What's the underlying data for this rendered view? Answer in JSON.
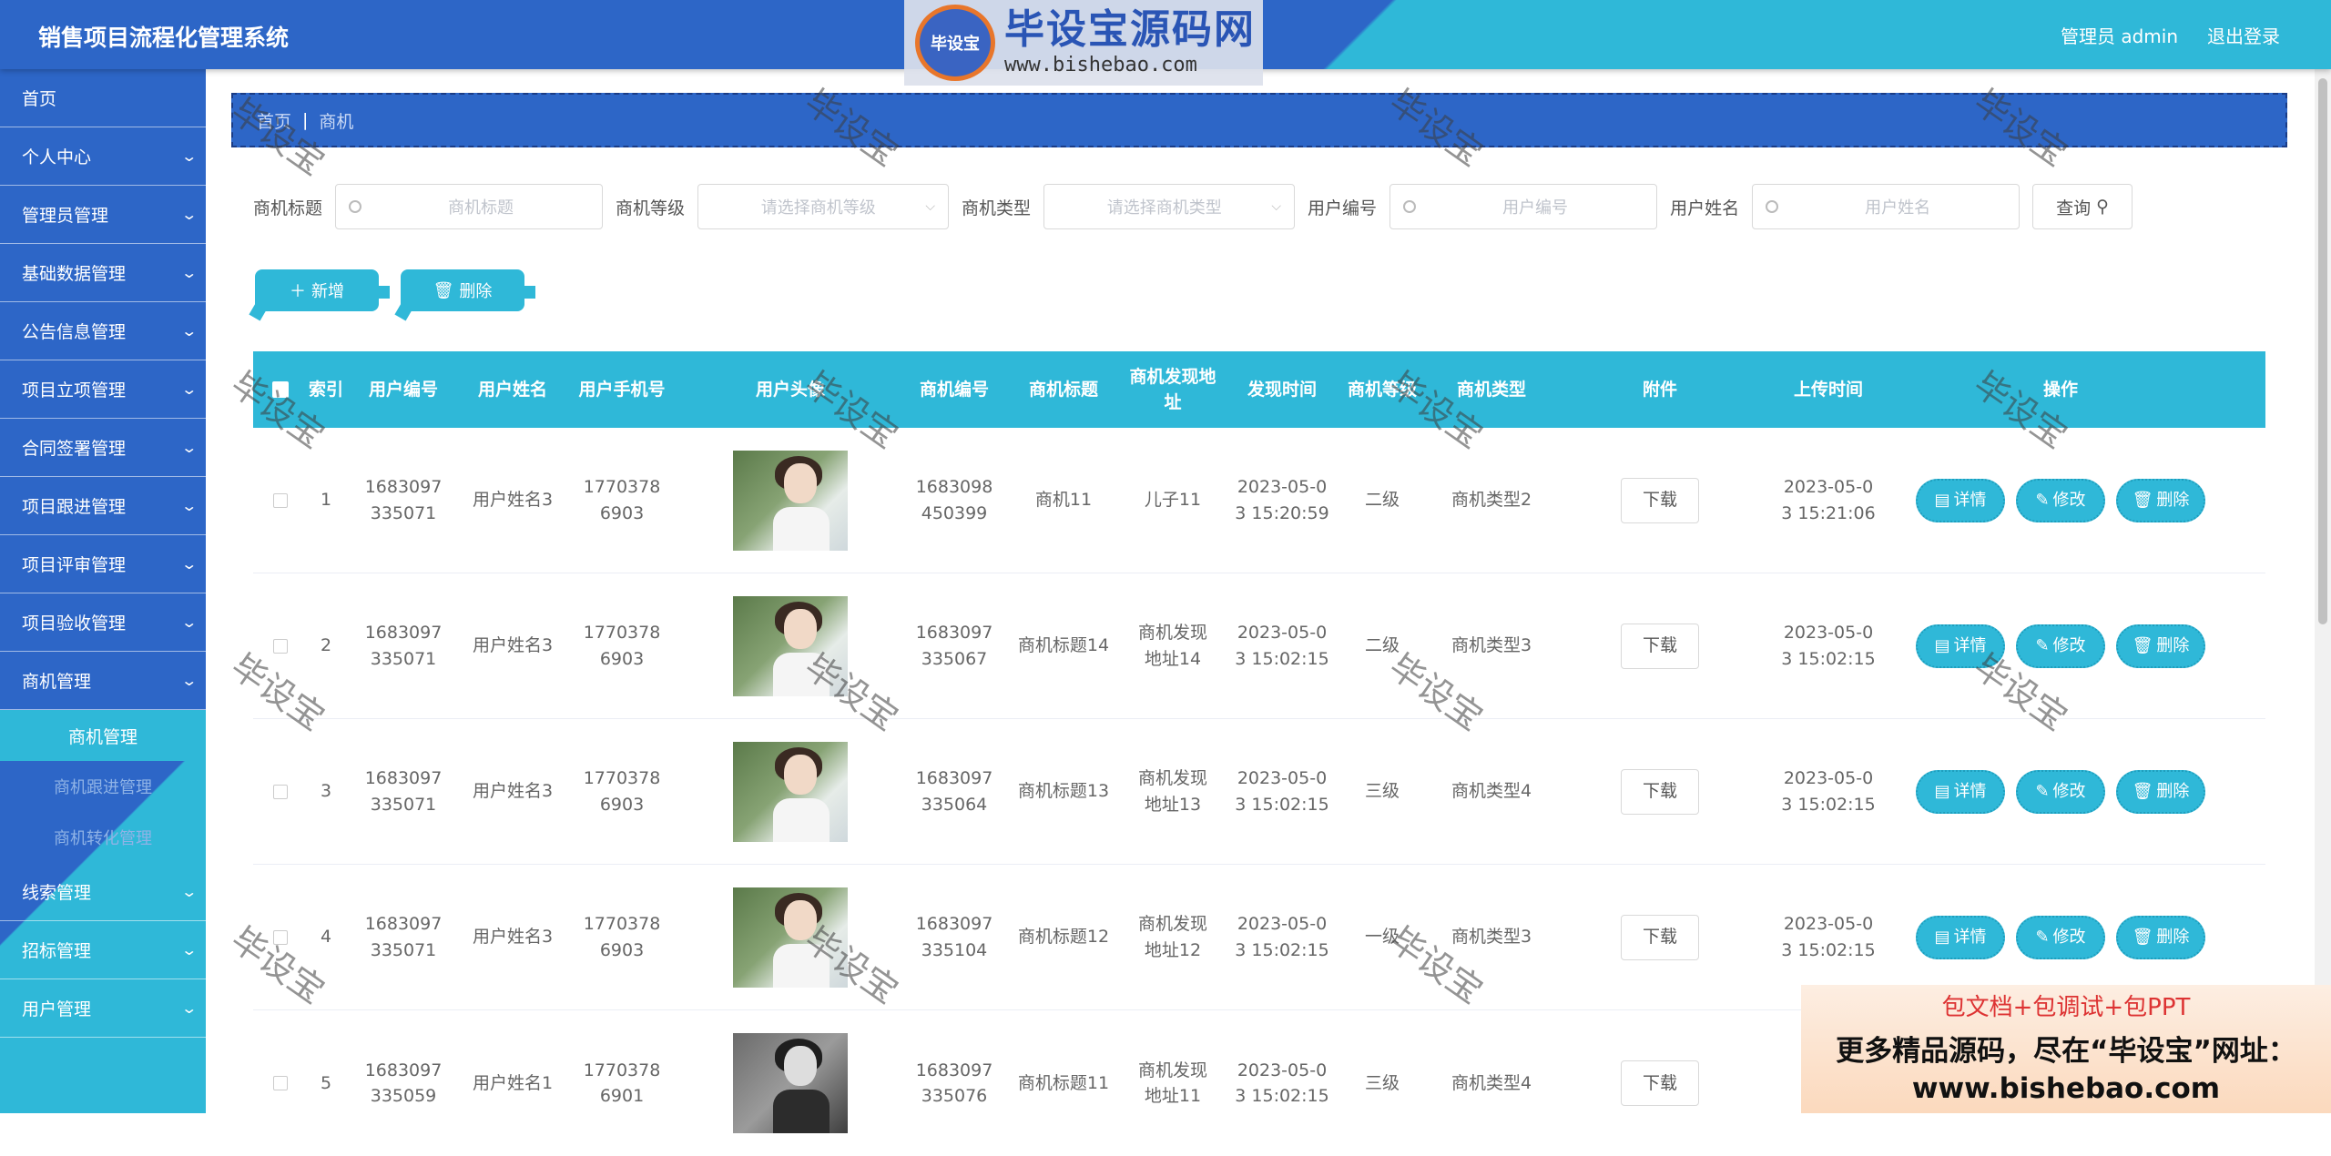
{
  "header": {
    "app_title": "销售项目流程化管理系统",
    "user_label": "管理员 admin",
    "logout": "退出登录",
    "logo_badge": "毕设宝",
    "logo_text": "毕设宝源码网",
    "logo_url": "www.bishebao.com"
  },
  "sidebar": {
    "items": [
      {
        "label": "首页"
      },
      {
        "label": "个人中心"
      },
      {
        "label": "管理员管理"
      },
      {
        "label": "基础数据管理"
      },
      {
        "label": "公告信息管理"
      },
      {
        "label": "项目立项管理"
      },
      {
        "label": "合同签署管理"
      },
      {
        "label": "项目跟进管理"
      },
      {
        "label": "项目评审管理"
      },
      {
        "label": "项目验收管理"
      },
      {
        "label": "商机管理"
      },
      {
        "label": "线索管理"
      },
      {
        "label": "招标管理"
      },
      {
        "label": "用户管理"
      }
    ],
    "sub_items": [
      "商机管理",
      "商机跟进管理",
      "商机转化管理"
    ]
  },
  "breadcrumb": {
    "home": "首页",
    "current": "商机"
  },
  "search": {
    "title_label": "商机标题",
    "title_ph": "商机标题",
    "level_label": "商机等级",
    "level_ph": "请选择商机等级",
    "type_label": "商机类型",
    "type_ph": "请选择商机类型",
    "uno_label": "用户编号",
    "uno_ph": "用户编号",
    "uname_label": "用户姓名",
    "uname_ph": "用户姓名",
    "query": "查询"
  },
  "actions": {
    "add": "新增",
    "delete": "删除"
  },
  "table": {
    "headers": [
      "索引",
      "用户编号",
      "用户姓名",
      "用户手机号",
      "用户头像",
      "商机编号",
      "商机标题",
      "商机发现地址",
      "发现时间",
      "商机等级",
      "商机类型",
      "附件",
      "上传时间",
      "操作"
    ],
    "download": "下载",
    "op_detail": "详情",
    "op_edit": "修改",
    "op_delete": "删除",
    "rows": [
      {
        "idx": "1",
        "uno": "1683097335071",
        "uname": "用户姓名3",
        "phone": "17703786903",
        "sno": "1683098450399",
        "stitle": "商机11",
        "saddr": "儿子11",
        "time": "2023-05-03 15:20:59",
        "level": "二级",
        "stype": "商机类型2",
        "up": "2023-05-03 15:21:06"
      },
      {
        "idx": "2",
        "uno": "1683097335071",
        "uname": "用户姓名3",
        "phone": "17703786903",
        "sno": "1683097335067",
        "stitle": "商机标题14",
        "saddr": "商机发现地址14",
        "time": "2023-05-03 15:02:15",
        "level": "二级",
        "stype": "商机类型3",
        "up": "2023-05-03 15:02:15"
      },
      {
        "idx": "3",
        "uno": "1683097335071",
        "uname": "用户姓名3",
        "phone": "17703786903",
        "sno": "1683097335064",
        "stitle": "商机标题13",
        "saddr": "商机发现地址13",
        "time": "2023-05-03 15:02:15",
        "level": "三级",
        "stype": "商机类型4",
        "up": "2023-05-03 15:02:15"
      },
      {
        "idx": "4",
        "uno": "1683097335071",
        "uname": "用户姓名3",
        "phone": "17703786903",
        "sno": "1683097335104",
        "stitle": "商机标题12",
        "saddr": "商机发现地址12",
        "time": "2023-05-03 15:02:15",
        "level": "一级",
        "stype": "商机类型3",
        "up": "2023-05-03 15:02:15"
      },
      {
        "idx": "5",
        "uno": "1683097335059",
        "uname": "用户姓名1",
        "phone": "17703786901",
        "sno": "1683097335076",
        "stitle": "商机标题11",
        "saddr": "商机发现地址11",
        "time": "2023-05-03 15:02:15",
        "level": "三级",
        "stype": "商机类型4",
        "up": ""
      }
    ]
  },
  "watermark": "毕设宝",
  "ad": {
    "line1": "包文档+包调试+包PPT",
    "line2": "更多精品源码，尽在“毕设宝”网址：",
    "line3": "www.bishebao.com"
  }
}
